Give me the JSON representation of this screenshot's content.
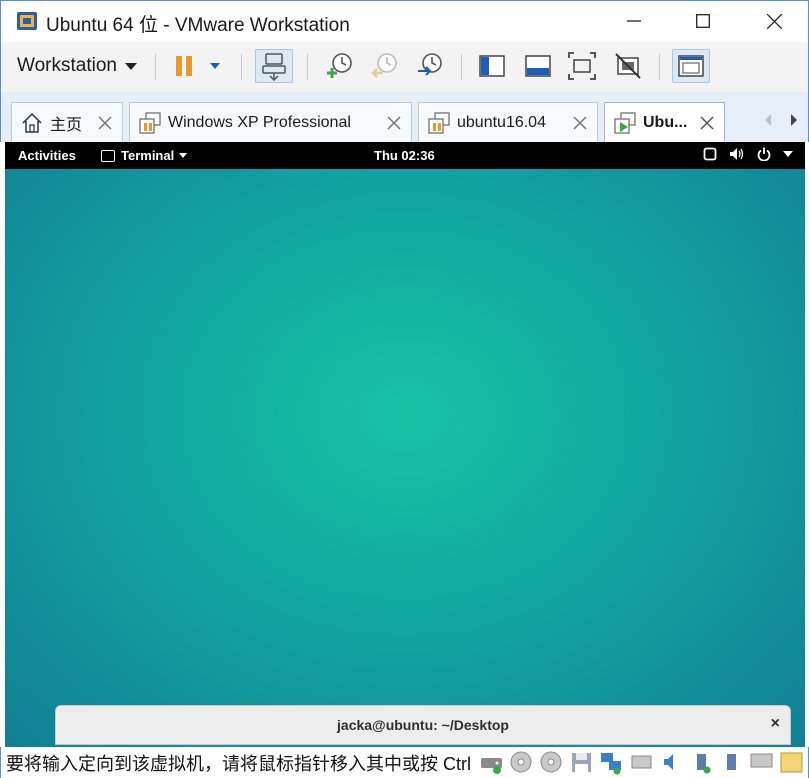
{
  "window": {
    "title": "Ubuntu 64 位 - VMware Workstation"
  },
  "toolbar": {
    "workstation_menu": "Workstation"
  },
  "tabs": [
    {
      "label": "主页"
    },
    {
      "label": "Windows XP Professional"
    },
    {
      "label": "ubuntu16.04"
    },
    {
      "label": "Ubu..."
    }
  ],
  "guest": {
    "topbar": {
      "activities": "Activities",
      "app_menu": "Terminal",
      "clock": "Thu 02:36"
    },
    "terminal_window": {
      "title": "jacka@ubuntu: ~/Desktop",
      "close_glyph": "×"
    }
  },
  "statusbar": {
    "hint": "要将输入定向到该虚拟机，请将鼠标指针移入其中或按 Ctrl"
  },
  "colors": {
    "window_border": "#5b8fc9",
    "tab_strip": "#e6eef8",
    "desktop_center": "#16c4a3",
    "desktop_edge": "#117f95",
    "pause_orange": "#e8972f",
    "accent_blue": "#1e5fb4"
  }
}
